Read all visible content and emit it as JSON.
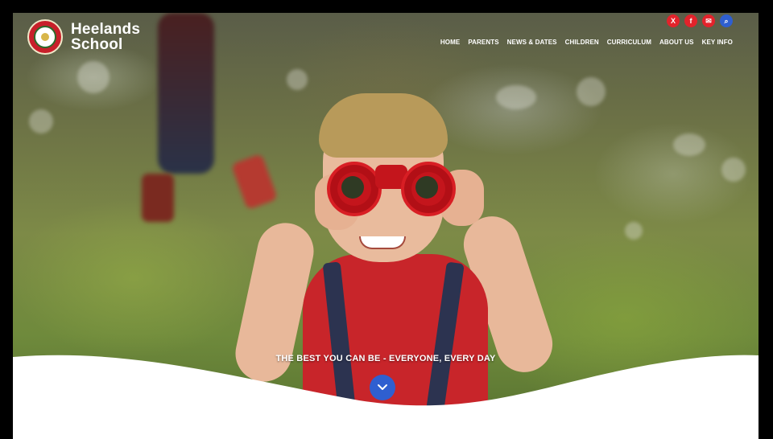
{
  "header": {
    "logo_line1": "Heelands",
    "logo_line2": "School",
    "social": [
      {
        "name": "x",
        "glyph": "X",
        "color": "#e2232b"
      },
      {
        "name": "facebook",
        "glyph": "f",
        "color": "#e2232b"
      },
      {
        "name": "email",
        "glyph": "✉",
        "color": "#e2232b"
      },
      {
        "name": "search",
        "glyph": "⌕",
        "color": "#2f5fd0"
      }
    ],
    "nav": [
      "HOME",
      "PARENTS",
      "NEWS & DATES",
      "CHILDREN",
      "CURRICULUM",
      "ABOUT US",
      "KEY INFO"
    ]
  },
  "hero": {
    "tagline": "THE BEST YOU CAN BE - EVERYONE, EVERY DAY"
  },
  "colors": {
    "brand_red": "#e2232b",
    "brand_blue": "#2f5fd0"
  }
}
